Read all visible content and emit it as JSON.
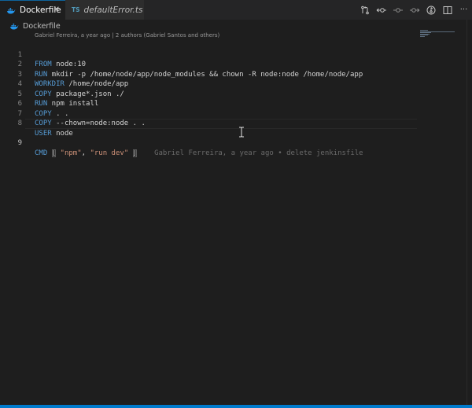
{
  "tabs": [
    {
      "label": "Dockerfile",
      "icon": "docker-whale-icon",
      "active": true,
      "close": "✕"
    },
    {
      "label": "defaultError.ts",
      "icon": "ts-icon",
      "badge": "TS",
      "active": false
    }
  ],
  "toolbar": {
    "icons": [
      "open-changes-icon",
      "commit-prev-icon",
      "commit-icon",
      "commit-next-icon",
      "toggle-blame-icon",
      "split-editor-icon",
      "more-actions-icon"
    ],
    "more_label": "···"
  },
  "breadcrumb": {
    "label": "Dockerfile"
  },
  "codelens": {
    "text": "Gabriel Ferreira, a year ago | 2 authors (Gabriel Santos and others)"
  },
  "lines": [
    {
      "num": "1",
      "kw": "FROM",
      "rest": " node:10"
    },
    {
      "num": "2",
      "kw": "RUN",
      "rest": " mkdir -p /home/node/app/node_modules && chown -R node:node /home/node/app"
    },
    {
      "num": "3",
      "kw": "WORKDIR",
      "rest": " /home/node/app"
    },
    {
      "num": "4",
      "kw": "COPY",
      "rest": " package*.json ./"
    },
    {
      "num": "5",
      "kw": "RUN",
      "rest": " npm install"
    },
    {
      "num": "6",
      "kw": "COPY",
      "rest": " . ."
    },
    {
      "num": "7",
      "kw": "COPY",
      "rest": " --chown=node:node . ."
    },
    {
      "num": "8",
      "kw": "USER",
      "rest": " node"
    }
  ],
  "line9": {
    "num": "9",
    "kw": "CMD",
    "open": "[",
    "str1": "\"npm\"",
    "comma": ", ",
    "str2": "\"run dev\"",
    "close": "]",
    "blame": "Gabriel Ferreira, a year ago • delete jenkinsfile"
  },
  "colors": {
    "background": "#1e1e1e",
    "keyword": "#569cd6",
    "string": "#ce9178",
    "accent": "#007acc"
  }
}
